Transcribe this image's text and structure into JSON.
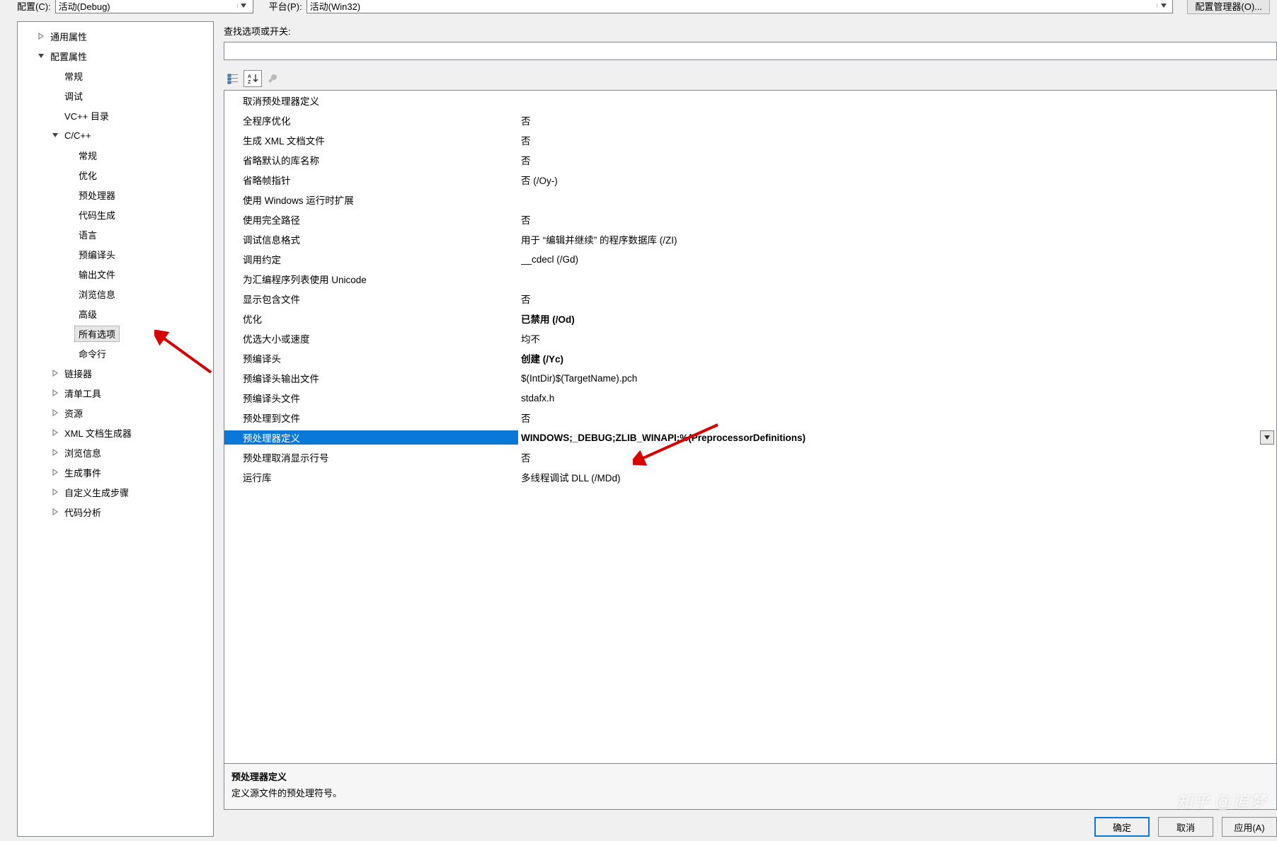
{
  "top": {
    "configLabel": "配置(C):",
    "configValue": "活动(Debug)",
    "platformLabel": "平台(P):",
    "platformValue": "活动(Win32)",
    "managerBtn": "配置管理器(O)..."
  },
  "tree": [
    {
      "indent": 1,
      "arrow": "right",
      "label": "通用属性"
    },
    {
      "indent": 1,
      "arrow": "down",
      "label": "配置属性"
    },
    {
      "indent": 2,
      "arrow": "",
      "label": "常规"
    },
    {
      "indent": 2,
      "arrow": "",
      "label": "调试"
    },
    {
      "indent": 2,
      "arrow": "",
      "label": "VC++ 目录"
    },
    {
      "indent": 2,
      "arrow": "down",
      "label": "C/C++"
    },
    {
      "indent": 3,
      "arrow": "",
      "label": "常规"
    },
    {
      "indent": 3,
      "arrow": "",
      "label": "优化"
    },
    {
      "indent": 3,
      "arrow": "",
      "label": "预处理器"
    },
    {
      "indent": 3,
      "arrow": "",
      "label": "代码生成"
    },
    {
      "indent": 3,
      "arrow": "",
      "label": "语言"
    },
    {
      "indent": 3,
      "arrow": "",
      "label": "预编译头"
    },
    {
      "indent": 3,
      "arrow": "",
      "label": "输出文件"
    },
    {
      "indent": 3,
      "arrow": "",
      "label": "浏览信息"
    },
    {
      "indent": 3,
      "arrow": "",
      "label": "高级"
    },
    {
      "indent": 3,
      "arrow": "",
      "label": "所有选项",
      "selected": true
    },
    {
      "indent": 3,
      "arrow": "",
      "label": "命令行"
    },
    {
      "indent": 2,
      "arrow": "right",
      "label": "链接器"
    },
    {
      "indent": 2,
      "arrow": "right",
      "label": "清单工具"
    },
    {
      "indent": 2,
      "arrow": "right",
      "label": "资源"
    },
    {
      "indent": 2,
      "arrow": "right",
      "label": "XML 文档生成器"
    },
    {
      "indent": 2,
      "arrow": "right",
      "label": "浏览信息"
    },
    {
      "indent": 2,
      "arrow": "right",
      "label": "生成事件"
    },
    {
      "indent": 2,
      "arrow": "right",
      "label": "自定义生成步骤"
    },
    {
      "indent": 2,
      "arrow": "right",
      "label": "代码分析"
    }
  ],
  "searchLabel": "查找选项或开关:",
  "props": [
    {
      "k": "取消预处理器定义",
      "v": ""
    },
    {
      "k": "全程序优化",
      "v": "否"
    },
    {
      "k": "生成 XML 文档文件",
      "v": "否"
    },
    {
      "k": "省略默认的库名称",
      "v": "否"
    },
    {
      "k": "省略帧指针",
      "v": "否 (/Oy-)"
    },
    {
      "k": "使用 Windows 运行时扩展",
      "v": ""
    },
    {
      "k": "使用完全路径",
      "v": "否"
    },
    {
      "k": "调试信息格式",
      "v": "用于 “编辑并继续” 的程序数据库 (/ZI)"
    },
    {
      "k": "调用约定",
      "v": "__cdecl (/Gd)"
    },
    {
      "k": "为汇编程序列表使用 Unicode",
      "v": ""
    },
    {
      "k": "显示包含文件",
      "v": "否"
    },
    {
      "k": "优化",
      "v": "已禁用 (/Od)",
      "bold": true
    },
    {
      "k": "优选大小或速度",
      "v": "均不"
    },
    {
      "k": "预编译头",
      "v": "创建 (/Yc)",
      "bold": true
    },
    {
      "k": "预编译头输出文件",
      "v": "$(IntDir)$(TargetName).pch"
    },
    {
      "k": "预编译头文件",
      "v": "stdafx.h"
    },
    {
      "k": "预处理到文件",
      "v": "否"
    },
    {
      "k": "预处理器定义",
      "v": "WINDOWS;_DEBUG;ZLIB_WINAPI;%(PreprocessorDefinitions)",
      "bold": true,
      "selected": true,
      "dd": true
    },
    {
      "k": "预处理取消显示行号",
      "v": "否"
    },
    {
      "k": "运行库",
      "v": "多线程调试 DLL (/MDd)"
    }
  ],
  "desc": {
    "title": "预处理器定义",
    "body": "定义源文件的预处理符号。"
  },
  "bottom": {
    "ok": "确定",
    "cancel": "取消",
    "apply": "应用(A)"
  },
  "watermark": "知乎 @追梦"
}
